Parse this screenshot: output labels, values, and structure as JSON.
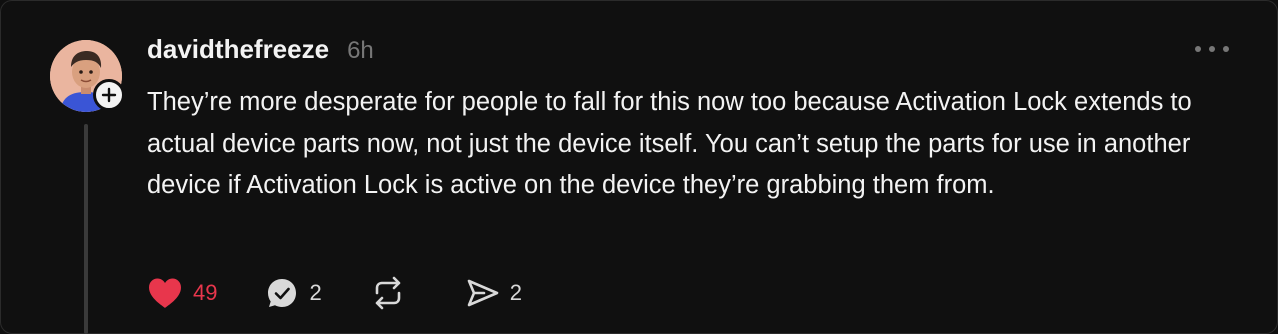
{
  "post": {
    "username": "davidthefreeze",
    "time": "6h",
    "text": "They’re more desperate for people to fall for this now too because Activation Lock extends to actual device parts now, not just the device itself. You can’t setup the parts for use in another device if Activation Lock is active on the device they’re grabbing them from.",
    "avatar_icon": "memoji-avatar",
    "follow_icon": "plus-icon",
    "more_icon": "more-horizontal-icon"
  },
  "actions": {
    "like": {
      "icon": "heart-icon",
      "count": "49",
      "liked": true,
      "color": "#e8364c"
    },
    "reply": {
      "icon": "reply-bubble-icon",
      "count": "2"
    },
    "repost": {
      "icon": "repost-icon",
      "count": ""
    },
    "share": {
      "icon": "send-icon",
      "count": "2"
    }
  },
  "colors": {
    "background": "#101010",
    "text": "#f3f3f3",
    "muted": "#777777",
    "like": "#e8364c"
  }
}
